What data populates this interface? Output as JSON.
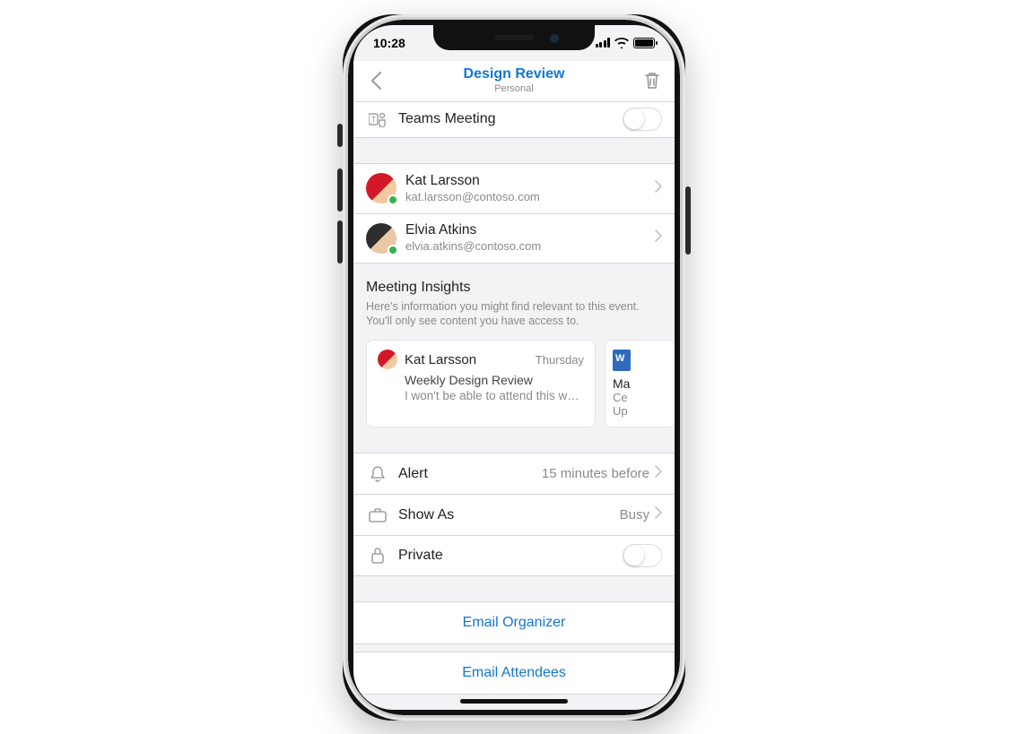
{
  "statusbar": {
    "time": "10:28"
  },
  "header": {
    "title": "Design Review",
    "subtitle": "Personal"
  },
  "teams_row": {
    "label": "Teams Meeting",
    "enabled": false
  },
  "people": [
    {
      "name": "Kat Larsson",
      "email": "kat.larsson@contoso.com",
      "avatar_bg": "#d31827",
      "avatar_fg": "#f3c9a0"
    },
    {
      "name": "Elvia Atkins",
      "email": "elvia.atkins@contoso.com",
      "avatar_bg": "#2e2e2e",
      "avatar_fg": "#e7c9a8"
    }
  ],
  "insights": {
    "heading": "Meeting Insights",
    "subheading": "Here's information you might find relevant to this event. You'll only see content you have access to.",
    "cards": [
      {
        "name": "Kat Larsson",
        "day": "Thursday",
        "subject": "Weekly Design Review",
        "preview": "I won't be able to attend this w…",
        "avatar_bg": "#d31827"
      },
      {
        "title_fragment": "Ma",
        "line2": "Ce",
        "line3": "Up"
      }
    ]
  },
  "settings": {
    "alert": {
      "label": "Alert",
      "value": "15 minutes before"
    },
    "show_as": {
      "label": "Show As",
      "value": "Busy"
    },
    "private": {
      "label": "Private",
      "enabled": false
    }
  },
  "actions": {
    "email_organizer": "Email Organizer",
    "email_attendees": "Email Attendees"
  }
}
